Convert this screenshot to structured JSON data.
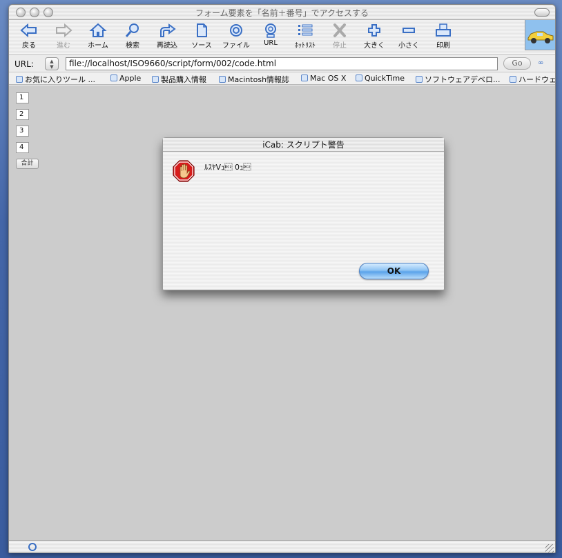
{
  "window": {
    "title": "フォーム要素を「名前＋番号」でアクセスする"
  },
  "toolbar": {
    "buttons": [
      {
        "label": "戻る",
        "icon": "back-arrow-icon"
      },
      {
        "label": "進む",
        "icon": "forward-arrow-icon"
      },
      {
        "label": "ホーム",
        "icon": "home-icon"
      },
      {
        "label": "検索",
        "icon": "search-icon"
      },
      {
        "label": "再読込",
        "icon": "reload-icon"
      },
      {
        "label": "ソース",
        "icon": "source-icon"
      },
      {
        "label": "ファイル",
        "icon": "file-icon"
      },
      {
        "label": "URL",
        "icon": "url-icon"
      },
      {
        "label": "ﾎｯﾄﾘｽﾄ",
        "icon": "hotlist-icon"
      },
      {
        "label": "停止",
        "icon": "stop-icon"
      },
      {
        "label": "大きく",
        "icon": "plus-icon"
      },
      {
        "label": "小さく",
        "icon": "minus-icon"
      },
      {
        "label": "印刷",
        "icon": "print-icon"
      }
    ]
  },
  "urlbar": {
    "label": "URL:",
    "value": "file://localhost/ISO9660/script/form/002/code.html",
    "go_label": "Go"
  },
  "bookmarks": [
    "お気に入りツール ...",
    "Apple",
    "製品購入情報",
    "Macintosh情報誌",
    "Mac OS X",
    "QuickTime",
    "ソフトウェアデベロ...",
    "ハードウェ"
  ],
  "form": {
    "fields": [
      "1",
      "2",
      "3",
      "4"
    ],
    "sum_label": "合計"
  },
  "dialog": {
    "title": "iCab: スクリプト警告",
    "message": "ﾙｽﾔVｭ\u0012 0ｭ\u0012",
    "ok_label": "OK"
  },
  "colors": {
    "desktop": "#4466a8",
    "content_bg": "#cccccc",
    "toolbar_icon": "#3a6fc4",
    "ok_button": "#5aa3ea",
    "stop_sign": "#d81c1c"
  }
}
